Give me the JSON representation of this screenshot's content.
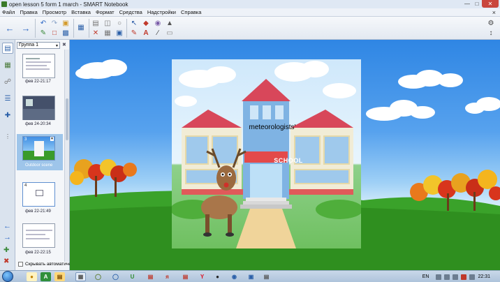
{
  "window": {
    "title": "open lesson 5 form 1 march - SMART Notebook"
  },
  "menu": [
    "Файл",
    "Правка",
    "Просмотр",
    "Вставка",
    "Формат",
    "Средства",
    "Надстройки",
    "Справка"
  ],
  "sorter": {
    "group": "Группа 1",
    "thumbnails": [
      {
        "number": "",
        "label": "фев 22-21:17"
      },
      {
        "number": "",
        "label": "фев 24-20:34"
      },
      {
        "number": "3",
        "label": "Outdoor scene"
      },
      {
        "number": "4",
        "label": "фев 22-21:49"
      },
      {
        "number": "",
        "label": "фев 22-22:15"
      }
    ],
    "autohide_label": "Скрывать автоматически"
  },
  "scene": {
    "school_sign": "SCHOOL",
    "caption": "meteorologists'"
  },
  "taskbar": {
    "lang": "EN",
    "clock": "22:31"
  },
  "colors": {
    "sky": "#2f86e4",
    "grass": "#2e9a20",
    "accent": "#c9463d"
  }
}
